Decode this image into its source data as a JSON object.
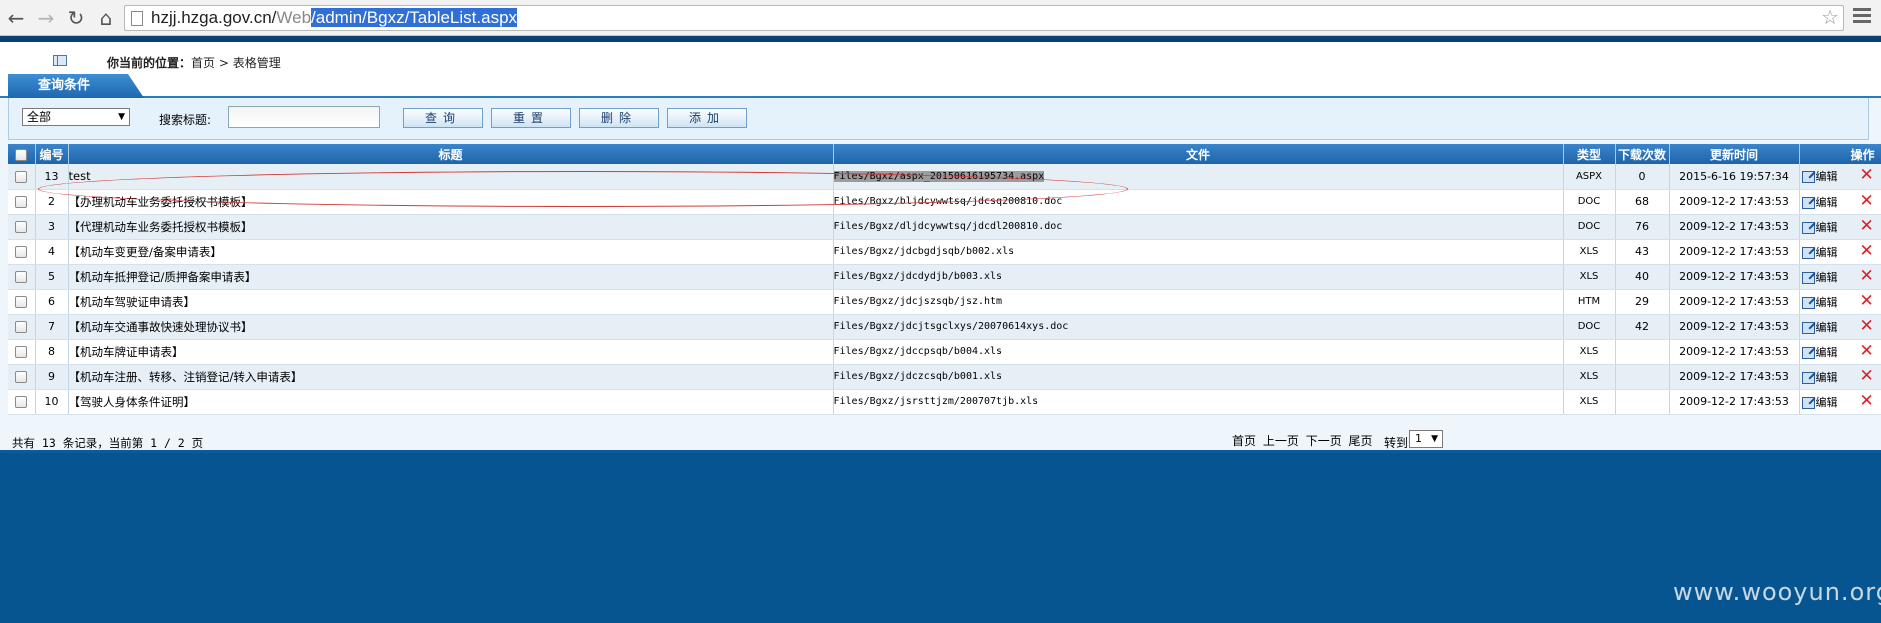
{
  "browser": {
    "url_host": "hzjj.hzga.gov.cn/",
    "url_path_plain": "Web",
    "url_path_selected": "/admin/Bgxz/TableList.aspx"
  },
  "breadcrumb": {
    "label": "你当前的位置：",
    "home": "首页",
    "separator": ">",
    "current": "表格管理"
  },
  "query": {
    "tab_label": "查询条件",
    "category_selected": "全部",
    "search_label": "搜索标题:",
    "search_value": "",
    "buttons": [
      "查询",
      "重置",
      "删除",
      "添加"
    ]
  },
  "table": {
    "headers": [
      "编号",
      "标题",
      "文件",
      "类型",
      "下载次数",
      "更新时间",
      "操作"
    ],
    "edit_label": "编辑",
    "rows": [
      {
        "id": "13",
        "title": "test",
        "file": "Files/Bgxz/aspx_20150616195734.aspx",
        "type": "ASPX",
        "downloads": "0",
        "updated": "2015-6-16 19:57:34"
      },
      {
        "id": "2",
        "title": "【办理机动车业务委托授权书模板】",
        "file": "Files/Bgxz/bljdcywwtsq/jdcsq200810.doc",
        "type": "DOC",
        "downloads": "68",
        "updated": "2009-12-2 17:43:53"
      },
      {
        "id": "3",
        "title": "【代理机动车业务委托授权书模板】",
        "file": "Files/Bgxz/dljdcywwtsq/jdcdl200810.doc",
        "type": "DOC",
        "downloads": "76",
        "updated": "2009-12-2 17:43:53"
      },
      {
        "id": "4",
        "title": "【机动车变更登/备案申请表】",
        "file": "Files/Bgxz/jdcbgdjsqb/b002.xls",
        "type": "XLS",
        "downloads": "43",
        "updated": "2009-12-2 17:43:53"
      },
      {
        "id": "5",
        "title": "【机动车抵押登记/质押备案申请表】",
        "file": "Files/Bgxz/jdcdydjb/b003.xls",
        "type": "XLS",
        "downloads": "40",
        "updated": "2009-12-2 17:43:53"
      },
      {
        "id": "6",
        "title": "【机动车驾驶证申请表】",
        "file": "Files/Bgxz/jdcjszsqb/jsz.htm",
        "type": "HTM",
        "downloads": "29",
        "updated": "2009-12-2 17:43:53"
      },
      {
        "id": "7",
        "title": "【机动车交通事故快速处理协议书】",
        "file": "Files/Bgxz/jdcjtsgclxys/20070614xys.doc",
        "type": "DOC",
        "downloads": "42",
        "updated": "2009-12-2 17:43:53"
      },
      {
        "id": "8",
        "title": "【机动车牌证申请表】",
        "file": "Files/Bgxz/jdccpsqb/b004.xls",
        "type": "XLS",
        "downloads": "",
        "updated": "2009-12-2 17:43:53"
      },
      {
        "id": "9",
        "title": "【机动车注册、转移、注销登记/转入申请表】",
        "file": "Files/Bgxz/jdczcsqb/b001.xls",
        "type": "XLS",
        "downloads": "",
        "updated": "2009-12-2 17:43:53"
      },
      {
        "id": "10",
        "title": "【驾驶人身体条件证明】",
        "file": "Files/Bgxz/jsrsttjzm/200707tjb.xls",
        "type": "XLS",
        "downloads": "",
        "updated": "2009-12-2 17:43:53"
      }
    ]
  },
  "pager": {
    "summary": "共有 13 条记录，当前第 1 / 2 页",
    "links": [
      "首页",
      "上一页",
      "下一页",
      "尾页"
    ],
    "goto_label": "转到",
    "goto_value": "1"
  },
  "watermark": "www.wooyun.org"
}
